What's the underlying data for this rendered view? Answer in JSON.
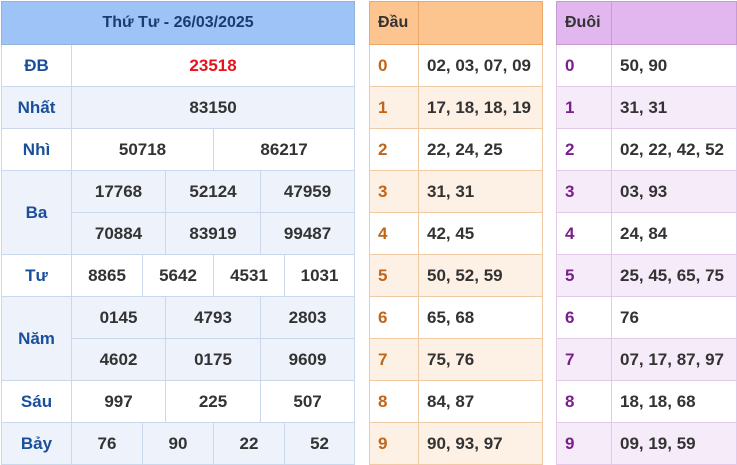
{
  "results": {
    "title": "Thứ Tư - 26/03/2025",
    "rows": [
      {
        "label": "ĐB",
        "values": [
          "23518"
        ]
      },
      {
        "label": "Nhất",
        "values": [
          "83150"
        ]
      },
      {
        "label": "Nhì",
        "values": [
          "50718",
          "86217"
        ]
      },
      {
        "label": "Ba",
        "values": [
          "17768",
          "52124",
          "47959",
          "70884",
          "83919",
          "99487"
        ]
      },
      {
        "label": "Tư",
        "values": [
          "8865",
          "5642",
          "4531",
          "1031"
        ]
      },
      {
        "label": "Năm",
        "values": [
          "0145",
          "4793",
          "2803",
          "4602",
          "0175",
          "9609"
        ]
      },
      {
        "label": "Sáu",
        "values": [
          "997",
          "225",
          "507"
        ]
      },
      {
        "label": "Bảy",
        "values": [
          "76",
          "90",
          "22",
          "52"
        ]
      }
    ]
  },
  "dau": {
    "header": "Đầu",
    "rows": [
      {
        "key": "0",
        "value": "02, 03, 07, 09"
      },
      {
        "key": "1",
        "value": "17, 18, 18, 19"
      },
      {
        "key": "2",
        "value": "22, 24, 25"
      },
      {
        "key": "3",
        "value": "31, 31"
      },
      {
        "key": "4",
        "value": "42, 45"
      },
      {
        "key": "5",
        "value": "50, 52, 59"
      },
      {
        "key": "6",
        "value": "65, 68"
      },
      {
        "key": "7",
        "value": "75, 76"
      },
      {
        "key": "8",
        "value": "84, 87"
      },
      {
        "key": "9",
        "value": "90, 93, 97"
      }
    ]
  },
  "duoi": {
    "header": "Đuôi",
    "rows": [
      {
        "key": "0",
        "value": "50, 90"
      },
      {
        "key": "1",
        "value": "31, 31"
      },
      {
        "key": "2",
        "value": "02, 22, 42, 52"
      },
      {
        "key": "3",
        "value": "03, 93"
      },
      {
        "key": "4",
        "value": "24, 84"
      },
      {
        "key": "5",
        "value": "25, 45, 65, 75"
      },
      {
        "key": "6",
        "value": "76"
      },
      {
        "key": "7",
        "value": "07, 17, 87, 97"
      },
      {
        "key": "8",
        "value": "18, 18, 68"
      },
      {
        "key": "9",
        "value": "09, 19, 59"
      }
    ]
  },
  "colors": {
    "special_prize": "#e8121d",
    "results_header": "#9ec3f7",
    "dau_header": "#fcc58f",
    "duoi_header": "#e2b6ef"
  }
}
